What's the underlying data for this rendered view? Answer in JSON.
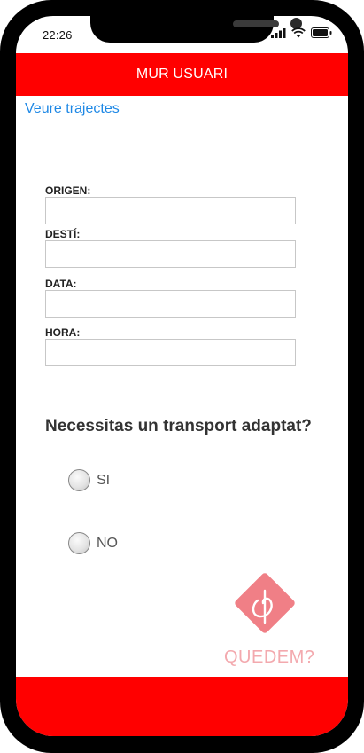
{
  "status_bar": {
    "time": "22:26"
  },
  "header": {
    "title": "MUR USUARI",
    "color": "#ff0000"
  },
  "nav": {
    "link_label": "Veure trajectes",
    "link_color": "#1e88e5"
  },
  "form": {
    "fields": [
      {
        "label": "ORIGEN:",
        "value": "",
        "placeholder": ""
      },
      {
        "label": "DESTÍ:",
        "value": "",
        "placeholder": ""
      },
      {
        "label": "DATA:",
        "value": "",
        "placeholder": ""
      },
      {
        "label": "HORA:",
        "value": "",
        "placeholder": ""
      }
    ],
    "question": "Necessitas un transport adaptat?",
    "options": [
      {
        "label": "SI",
        "selected": false
      },
      {
        "label": "NO",
        "selected": false
      }
    ]
  },
  "logo": {
    "text": "QUEDEM?",
    "color": "#f07f86"
  },
  "footer": {
    "color": "#ff0000"
  }
}
